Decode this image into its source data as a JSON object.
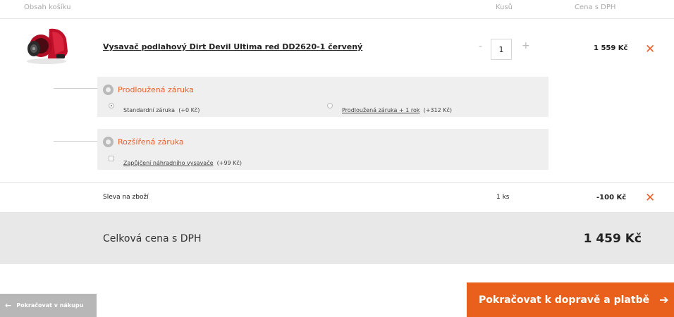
{
  "headers": {
    "cart_contents": "Obsah košíku",
    "quantity": "Kusů",
    "price_vat": "Cena s DPH"
  },
  "product": {
    "name": "Vysavač podlahový Dirt Devil Ultima red DD2620-1 červený",
    "qty": "1",
    "minus": "-",
    "plus": "+",
    "price": "1 559 Kč",
    "remove": "✕",
    "image_icon": "vacuum-cleaner-image",
    "accent_color": "#e8612c"
  },
  "warranty_extended": {
    "title": "Prodloužená záruka",
    "options": [
      {
        "label": "Standardní záruka",
        "extra": "(+0 Kč)",
        "selected": true
      },
      {
        "label": "Prodloužená záruka + 1 rok",
        "extra": "(+312 Kč)",
        "selected": false
      }
    ]
  },
  "warranty_expanded": {
    "title": "Rozšířená záruka",
    "option": {
      "label": "Zapůjčení náhradního vysavače",
      "extra": "(+99 Kč)",
      "checked": false
    }
  },
  "discount": {
    "label": "Sleva na zboží",
    "qty": "1 ks",
    "price": "-100 Kč",
    "remove": "✕"
  },
  "total": {
    "label": "Celková cena s DPH",
    "value": "1 459 Kč"
  },
  "buttons": {
    "back_arrow": "←",
    "back": "Pokračovat v nákupu",
    "next": "Pokračovat k dopravě a platbě",
    "next_arrow": "➔",
    "next_color": "#e8601c"
  }
}
